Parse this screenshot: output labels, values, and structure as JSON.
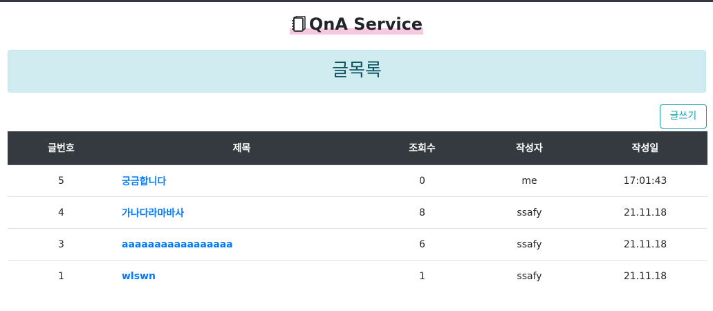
{
  "header": {
    "title": "QnA Service",
    "icon": "notebook-icon"
  },
  "banner": {
    "text": "글목록"
  },
  "toolbar": {
    "write_label": "글쓰기"
  },
  "table": {
    "columns": [
      "글번호",
      "제목",
      "조회수",
      "작성자",
      "작성일"
    ],
    "rows": [
      {
        "no": "5",
        "subject": "궁금합니다",
        "views": "0",
        "author": "me",
        "date": "17:01:43"
      },
      {
        "no": "4",
        "subject": "가나다라마바사",
        "views": "8",
        "author": "ssafy",
        "date": "21.11.18"
      },
      {
        "no": "3",
        "subject": "aaaaaaaaaaaaaaaaa",
        "views": "6",
        "author": "ssafy",
        "date": "21.11.18"
      },
      {
        "no": "1",
        "subject": "wlswn",
        "views": "1",
        "author": "ssafy",
        "date": "21.11.18"
      }
    ]
  },
  "colors": {
    "topbar": "#343a40",
    "banner_bg": "#d1ecf1",
    "banner_text": "#0c5460",
    "link": "#007bff",
    "button_outline": "#17a2b8"
  }
}
